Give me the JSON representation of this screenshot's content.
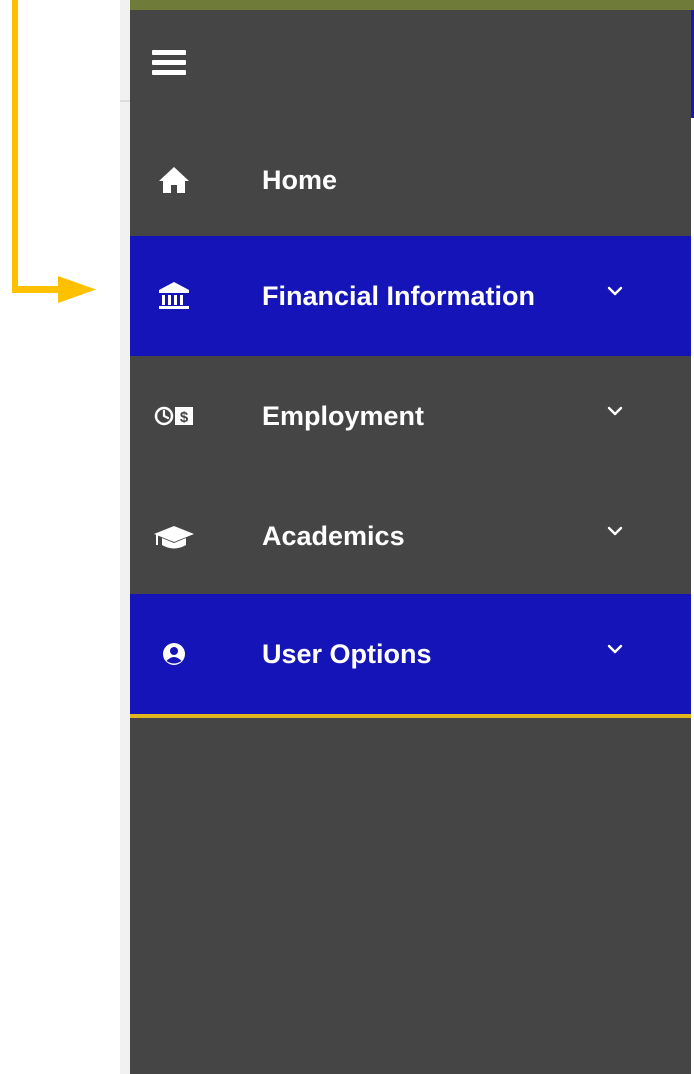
{
  "sidebar": {
    "menu_icon": "hamburger-menu-icon",
    "items": [
      {
        "label": "Home",
        "icon": "home-icon",
        "has_chevron": false,
        "active": false
      },
      {
        "label": "Financial Information",
        "icon": "bank-icon",
        "has_chevron": true,
        "active": true
      },
      {
        "label": "Employment",
        "icon": "clock-dollar-icon",
        "has_chevron": true,
        "active": false
      },
      {
        "label": "Academics",
        "icon": "graduation-cap-icon",
        "has_chevron": true,
        "active": false
      },
      {
        "label": "User Options",
        "icon": "user-circle-icon",
        "has_chevron": true,
        "active": true
      }
    ]
  },
  "colors": {
    "sidebar_bg": "#454545",
    "active_bg": "#1414b8",
    "highlight_border": "#e0b51e",
    "annotation_arrow": "#ffc000",
    "text": "#ffffff"
  }
}
